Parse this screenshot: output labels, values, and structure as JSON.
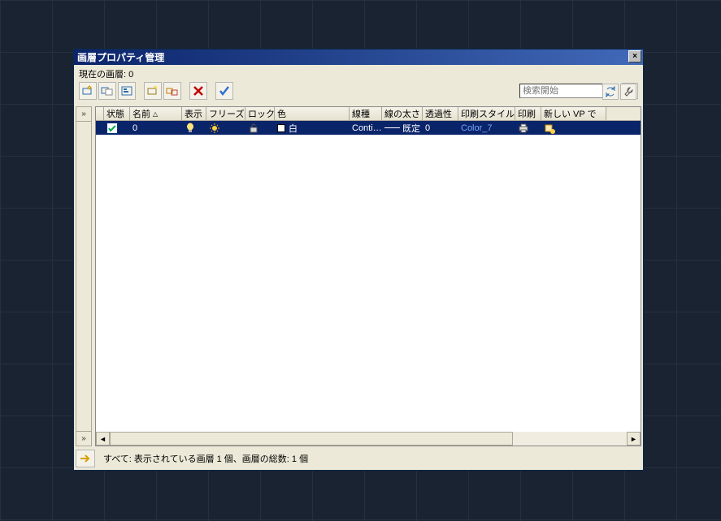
{
  "window": {
    "title": "画層プロパティ管理"
  },
  "current_layer_label": "現在の画層: 0",
  "search": {
    "placeholder": "検索開始"
  },
  "columns": {
    "state": "状態",
    "name": "名前",
    "show": "表示",
    "freeze": "フリーズ",
    "lock": "ロック",
    "color": "色",
    "linetype": "線種",
    "lineweight": "線の太さ",
    "transparency": "透過性",
    "plotstyle": "印刷スタイル",
    "plot": "印刷",
    "newvp": "新しい VP で"
  },
  "row": {
    "name": "0",
    "color_name": "白",
    "linetype": "Conti…",
    "lineweight": "既定",
    "transparency": "0",
    "plotstyle": "Color_7"
  },
  "status_text": "すべて: 表示されている画層 1 個、画層の総数: 1 個"
}
